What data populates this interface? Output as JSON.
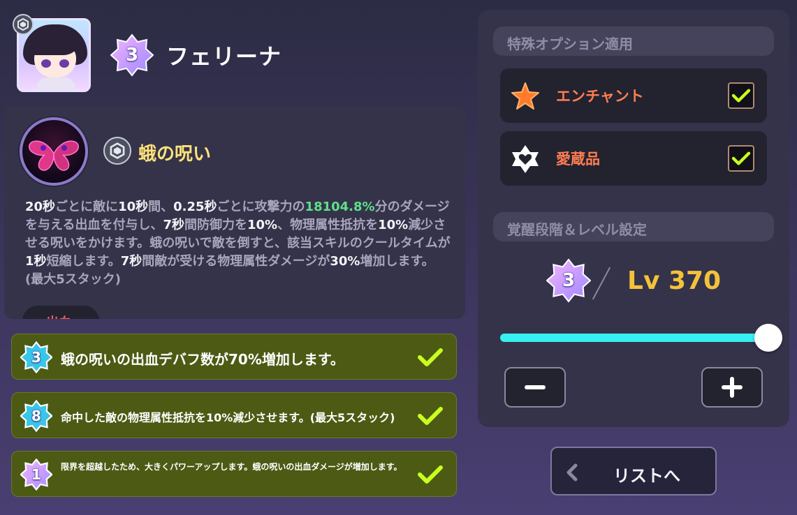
{
  "character": {
    "name": "フェリーナ",
    "star_level": "3"
  },
  "skill": {
    "name": "蛾の呪い",
    "description": [
      {
        "t": "20秒",
        "c": "w"
      },
      {
        "t": "ごとに敵に",
        "c": ""
      },
      {
        "t": "10秒",
        "c": "w"
      },
      {
        "t": "間、",
        "c": ""
      },
      {
        "t": "0.25秒",
        "c": "w"
      },
      {
        "t": "ごとに攻撃力の",
        "c": ""
      },
      {
        "t": "18104.8%",
        "c": "g"
      },
      {
        "t": "分のダメージを与える出血を付与し、",
        "c": ""
      },
      {
        "t": "7秒",
        "c": "w"
      },
      {
        "t": "間防御力を",
        "c": ""
      },
      {
        "t": "10%",
        "c": "w"
      },
      {
        "t": "、物理属性抵抗を",
        "c": ""
      },
      {
        "t": "10%",
        "c": "w"
      },
      {
        "t": "減少させる呪いをかけます。蛾の呪いで敵を倒すと、該当スキルのクールタイムが",
        "c": ""
      },
      {
        "t": "1秒",
        "c": "w"
      },
      {
        "t": "短縮します。",
        "c": ""
      },
      {
        "t": "7秒",
        "c": "w"
      },
      {
        "t": "間敵が受ける物理属性ダメージが",
        "c": ""
      },
      {
        "t": "30%",
        "c": "w"
      },
      {
        "t": "増加します。(最大5スタック)",
        "c": ""
      }
    ],
    "tag": "出血"
  },
  "potentials": [
    {
      "rank": "3",
      "text": "蛾の呪いの出血デバフ数が70%増加します。",
      "badge_color": "#39c6e8",
      "checked": true
    },
    {
      "rank": "8",
      "text": "命中した敵の物理属性抵抗を10%減少させます。(最大5スタック)",
      "badge_color": "#39c6e8",
      "checked": true
    },
    {
      "rank": "1",
      "text": "限界を超越したため、大きくパワーアップします。蛾の呪いの出血ダメージが増加します。",
      "badge_color": "#c9a0f0",
      "checked": true
    }
  ],
  "special_options": {
    "header": "特殊オプション適用",
    "items": [
      {
        "label": "エンチャント",
        "icon": "star-icon",
        "checked": true
      },
      {
        "label": "愛蔵品",
        "icon": "heart-badge-icon",
        "checked": true
      }
    ]
  },
  "awakening": {
    "header": "覚醒段階＆レベル設定",
    "star_level": "3",
    "level_label": "Lv 370",
    "slider_fraction": 1.0
  },
  "list_button": {
    "label": "リストへ"
  },
  "colors": {
    "accent_cyan": "#36f0f2",
    "level_gold": "#f3c23a",
    "option_orange": "#ff7e53",
    "check_lime": "#c8ff1e",
    "potential_green": "#4c5a14"
  }
}
